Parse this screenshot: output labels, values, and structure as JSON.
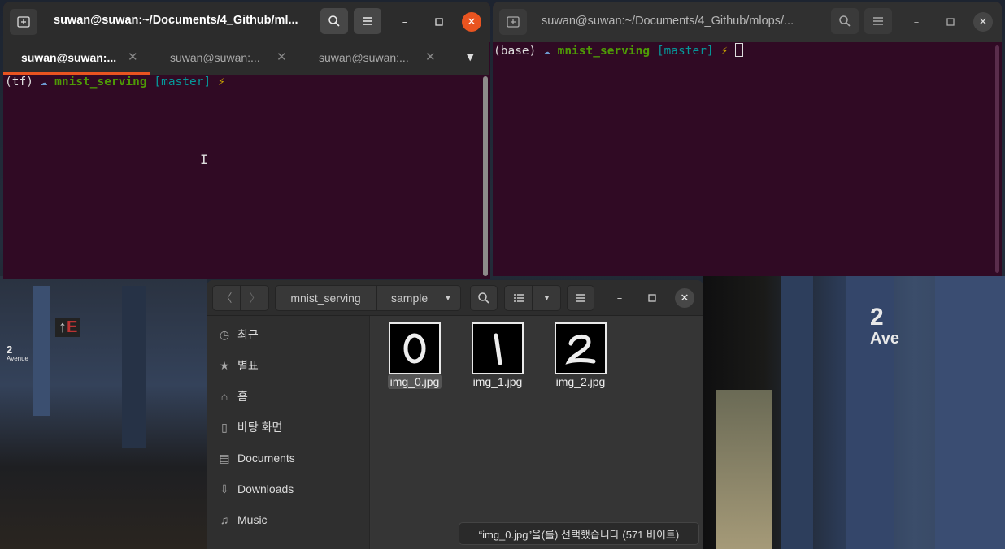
{
  "desktop": {
    "sign_left_number": "2",
    "sign_left_text": "Avenue",
    "sign_right_number": "2",
    "sign_right_text": "Ave",
    "sign_exit": "E"
  },
  "terminal_left": {
    "title": "suwan@suwan:~/Documents/4_Github/ml...",
    "tabs": [
      {
        "label": "suwan@suwan:..."
      },
      {
        "label": "suwan@suwan:..."
      },
      {
        "label": "suwan@suwan:..."
      }
    ],
    "prompt": {
      "env": "(tf)",
      "dir": "mnist_serving",
      "branch": "[master]",
      "bolt": "⚡"
    }
  },
  "terminal_right": {
    "title": "suwan@suwan:~/Documents/4_Github/mlops/...",
    "prompt": {
      "env": "(base)",
      "dir": "mnist_serving",
      "branch": "[master]",
      "bolt": "⚡"
    }
  },
  "file_manager": {
    "path": [
      "mnist_serving",
      "sample"
    ],
    "sidebar": [
      {
        "label": "최근",
        "icon": "clock-icon"
      },
      {
        "label": "별표",
        "icon": "star-icon"
      },
      {
        "label": "홈",
        "icon": "home-icon"
      },
      {
        "label": "바탕 화면",
        "icon": "desktop-icon"
      },
      {
        "label": "Documents",
        "icon": "document-icon"
      },
      {
        "label": "Downloads",
        "icon": "download-icon"
      },
      {
        "label": "Music",
        "icon": "music-icon"
      }
    ],
    "files": [
      {
        "name": "img_0.jpg",
        "digit": "0",
        "selected": true
      },
      {
        "name": "img_1.jpg",
        "digit": "1",
        "selected": false
      },
      {
        "name": "img_2.jpg",
        "digit": "2",
        "selected": false
      }
    ],
    "status": "“img_0.jpg”을(를) 선택했습니다  (571 바이트)"
  },
  "colors": {
    "terminal_bg": "#300a24",
    "prompt_green": "#4e9a06",
    "prompt_cyan": "#06989a",
    "bolt": "#c4a000",
    "close_orange": "#e95420"
  }
}
